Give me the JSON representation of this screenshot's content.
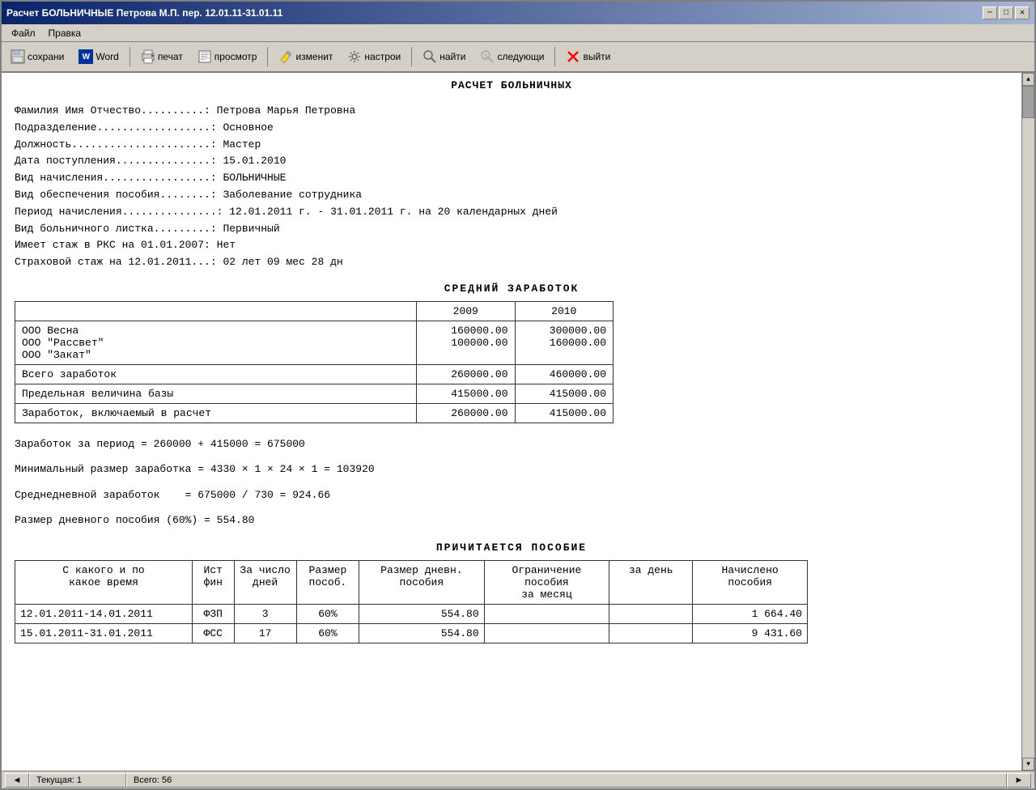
{
  "window": {
    "title": "Расчет БОЛЬНИЧНЫЕ Петрова М.П. пер. 12.01.11-31.01.11"
  },
  "titlebar": {
    "minimize_label": "─",
    "maximize_label": "□",
    "close_label": "✕"
  },
  "menu": {
    "items": [
      "Файл",
      "Правка"
    ]
  },
  "toolbar": {
    "save_label": "сохрани",
    "word_label": "Word",
    "print_label": "печат",
    "preview_label": "просмотр",
    "edit_label": "изменит",
    "settings_label": "настрои",
    "find_label": "найти",
    "next_label": "следующи",
    "exit_label": "выйти"
  },
  "doc": {
    "title": "РАСЧЕТ БОЛЬНИЧНЫХ",
    "info": {
      "fio_label": "Фамилия Имя Отчество..........: ",
      "fio_value": "Петрова Марья Петровна",
      "dept_label": "Подразделение..................: ",
      "dept_value": "Основное",
      "position_label": "Должность......................: ",
      "position_value": "Мастер",
      "hire_date_label": "Дата поступления...............: ",
      "hire_date_value": "15.01.2010",
      "accrual_label": "Вид начисления.................: ",
      "accrual_value": "БОЛЬНИЧНЫЕ",
      "benefit_label": "Вид обеспечения пособия........: ",
      "benefit_value": "Заболевание сотрудника",
      "period_label": "Период начисления...............: ",
      "period_value": "12.01.2011 г. - 31.01.2011 г. на 20 календарных дней",
      "sick_type_label": "Вид больничного листка.........: ",
      "sick_type_value": "Первичный",
      "rkc_label": "Имеет стаж в РКС на 01.01.2007: ",
      "rkc_value": "Нет",
      "insurance_label": "Страховой стаж на 12.01.2011...: ",
      "insurance_value": "02 лет 09 мес 28 дн"
    },
    "avg_earnings": {
      "title": "СРЕДНИЙ   ЗАРАБОТОК",
      "col1_header": "",
      "col2_header": "2009",
      "col3_header": "2010",
      "rows": [
        {
          "label": "ООО Весна",
          "val2009": "",
          "val2010": "300000.00"
        },
        {
          "label": "ООО \"Рассвет\"",
          "val2009": "160000.00",
          "val2010": "160000.00"
        },
        {
          "label": "ООО \"Закат\"",
          "val2009": "100000.00",
          "val2010": ""
        }
      ],
      "total_row": {
        "label": "Всего заработок",
        "val2009": "260000.00",
        "val2010": "460000.00"
      },
      "limit_row": {
        "label": "Предельная величина базы",
        "val2009": "415000.00",
        "val2010": "415000.00"
      },
      "included_row": {
        "label": "Заработок, включаемый в расчет",
        "val2009": "260000.00",
        "val2010": "415000.00"
      }
    },
    "calculations": {
      "period_earnings": "Заработок за период = 260000 + 415000 = 675000",
      "min_earnings": "Минимальный размер заработка = 4330 × 1 × 24 × 1 = 103920",
      "avg_daily": "Среднедневной заработок    = 675000 / 730 = 924.66",
      "daily_benefit": "Размер дневного пособия (60%) = 554.80"
    },
    "benefits": {
      "title": "ПРИЧИТАЕТСЯ ПОСОБИЕ",
      "headers": {
        "period": "С какого и по\nкакое время",
        "source": "Ист\nфин",
        "days": "За число\nдней",
        "benefit_pct": "Размер\nпособ.",
        "daily_benefit": "Размер дневн.\nпособия",
        "month_limit": "Ограничение пособия\nза месяц",
        "day_limit": "за день",
        "accrued": "Начислено\nпособия"
      },
      "rows": [
        {
          "period": "12.01.2011-14.01.2011",
          "source": "ФЗП",
          "days": "3",
          "pct": "60%",
          "daily": "554.80",
          "month_limit": "",
          "day_limit": "",
          "accrued": "1 664.40"
        },
        {
          "period": "15.01.2011-31.01.2011",
          "source": "ФСС",
          "days": "17",
          "pct": "60%",
          "daily": "554.80",
          "month_limit": "",
          "day_limit": "",
          "accrued": "9 431.60"
        }
      ]
    }
  },
  "statusbar": {
    "current_label": "Текущая:",
    "current_value": "1",
    "total_label": "Всего:",
    "total_value": "56"
  }
}
